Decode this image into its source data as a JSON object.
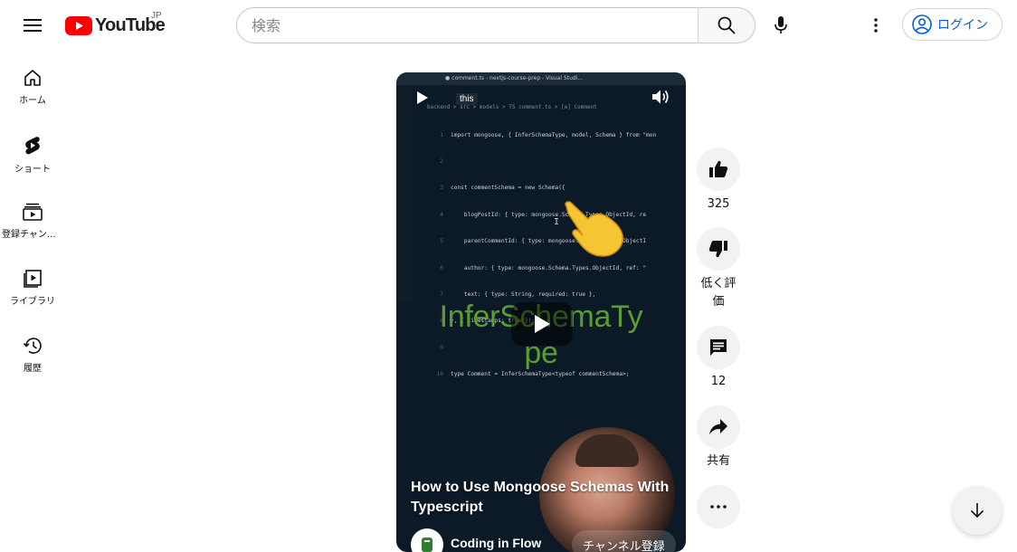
{
  "header": {
    "logo_text": "YouTube",
    "region": "JP",
    "search_placeholder": "検索",
    "login_label": "ログイン"
  },
  "sidebar": {
    "items": [
      {
        "label": "ホーム",
        "icon": "home-icon"
      },
      {
        "label": "ショート",
        "icon": "shorts-icon"
      },
      {
        "label": "登録チャンネル",
        "icon": "subscriptions-icon"
      },
      {
        "label": "ライブラリ",
        "icon": "library-icon"
      },
      {
        "label": "履歴",
        "icon": "history-icon"
      }
    ]
  },
  "video": {
    "title": "How to Use Mongoose Schemas With Typescript",
    "overlay_text_line1": "InferSchemaTy",
    "overlay_text_line2": "pe",
    "caption_tag": "this",
    "window_title": "● comment.ts - nextjs-course-prep - Visual Studi...",
    "breadcrumb": "backend > src > models > TS comment.ts > [e] Comment",
    "channel_name": "Coding in Flow",
    "subscribe_label": "チャンネル登録",
    "code_lines": [
      {
        "n": "1",
        "text": "import mongoose, { InferSchemaType, model, Schema } from \"mon"
      },
      {
        "n": "2",
        "text": ""
      },
      {
        "n": "3",
        "text": "const commentSchema = new Schema({"
      },
      {
        "n": "4",
        "text": "    blogPostId: { type: mongoose.Schema.Types.ObjectId, re"
      },
      {
        "n": "5",
        "text": "    parentCommentId: { type: mongoose.Schema.Types.ObjectI"
      },
      {
        "n": "6",
        "text": "    author: { type: mongoose.Schema.Types.ObjectId, ref: \""
      },
      {
        "n": "7",
        "text": "    text: { type: String, required: true },"
      },
      {
        "n": "8",
        "text": "}, { timestamps: true });"
      },
      {
        "n": "9",
        "text": ""
      },
      {
        "n": "10",
        "text": "type Comment = InferSchemaType<typeof commentSchema>;"
      }
    ]
  },
  "actions": {
    "like_count": "325",
    "dislike_label": "低く評価",
    "comment_count": "12",
    "share_label": "共有"
  }
}
